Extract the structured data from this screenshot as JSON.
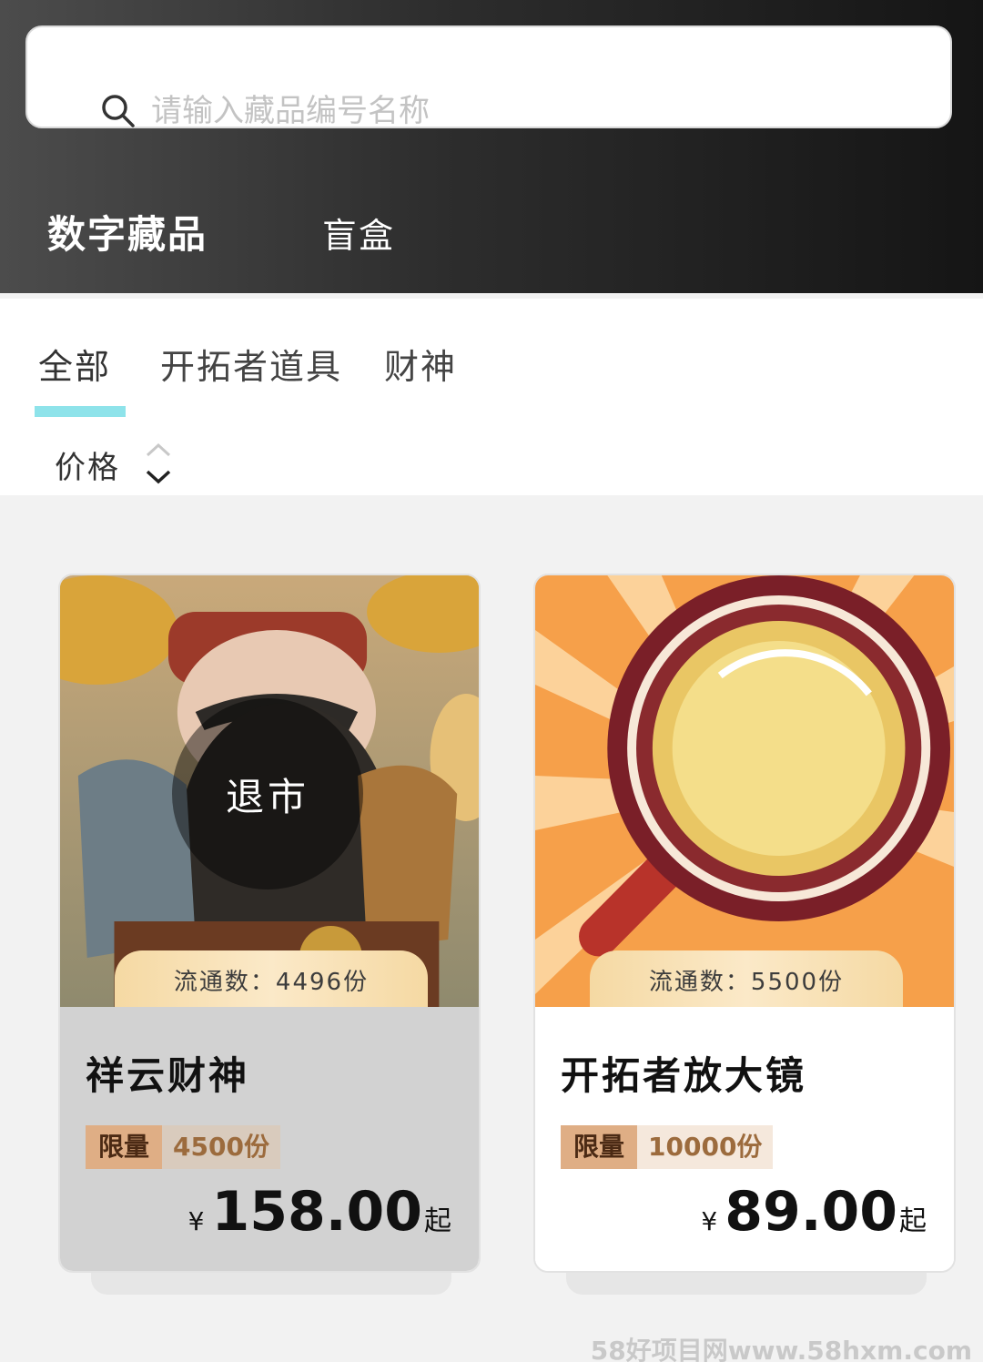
{
  "search": {
    "placeholder": "请输入藏品编号名称"
  },
  "main_tabs": [
    {
      "label": "数字藏品"
    },
    {
      "label": "盲盒"
    }
  ],
  "category_tabs": [
    {
      "label": "全部"
    },
    {
      "label": "开拓者道具"
    },
    {
      "label": "财神"
    }
  ],
  "sort": {
    "label": "价格"
  },
  "cards": [
    {
      "name": "祥云财神",
      "status": "退市",
      "circulation": "流通数：4496份",
      "limit_key": "限量",
      "limit_value": "4500份",
      "currency": "¥",
      "price": "158.00",
      "price_suffix": "起"
    },
    {
      "name": "开拓者放大镜",
      "circulation": "流通数：5500份",
      "limit_key": "限量",
      "limit_value": "10000份",
      "currency": "¥",
      "price": "89.00",
      "price_suffix": "起"
    }
  ],
  "watermark": "58好项目网www.58hxm.com",
  "colors": {
    "accent_underline": "#8ee3ea",
    "limit_tag": "#dfae85",
    "header_dark": "#151515"
  }
}
